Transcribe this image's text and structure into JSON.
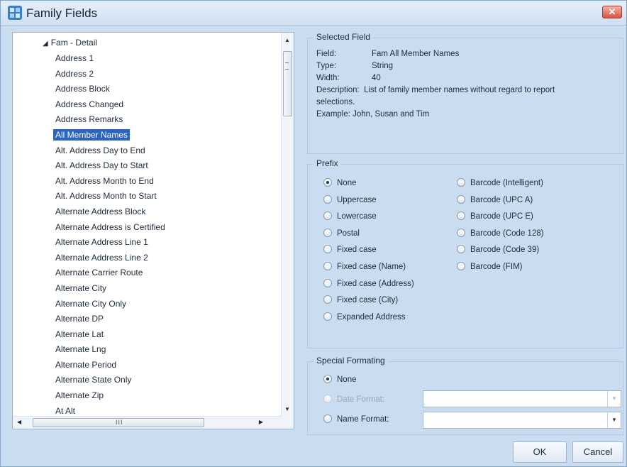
{
  "window": {
    "title": "Family Fields",
    "close_label": "✕"
  },
  "tree": {
    "root_label": "Fam - Detail",
    "items": [
      {
        "label": "Address 1"
      },
      {
        "label": "Address 2"
      },
      {
        "label": "Address Block"
      },
      {
        "label": "Address Changed"
      },
      {
        "label": "Address Remarks"
      },
      {
        "label": "All Member Names",
        "selected": true
      },
      {
        "label": "Alt. Address Day to End"
      },
      {
        "label": "Alt. Address Day to Start"
      },
      {
        "label": "Alt. Address Month to End"
      },
      {
        "label": "Alt. Address Month to Start"
      },
      {
        "label": "Alternate Address Block"
      },
      {
        "label": "Alternate Address is Certified"
      },
      {
        "label": "Alternate Address Line 1"
      },
      {
        "label": "Alternate Address Line 2"
      },
      {
        "label": "Alternate Carrier Route"
      },
      {
        "label": "Alternate City"
      },
      {
        "label": "Alternate City Only"
      },
      {
        "label": "Alternate DP"
      },
      {
        "label": "Alternate Lat"
      },
      {
        "label": "Alternate Lng"
      },
      {
        "label": "Alternate Period"
      },
      {
        "label": "Alternate State Only"
      },
      {
        "label": "Alternate Zip"
      },
      {
        "label": "At Alt"
      }
    ],
    "hscroll_grip": "III"
  },
  "selected_field": {
    "title": "Selected Field",
    "field_key": "Field:",
    "field_value": "Fam All Member Names",
    "type_key": "Type:",
    "type_value": "String",
    "width_key": "Width:",
    "width_value": "40",
    "description_key": "Description:",
    "description_line1": "List of family member names without regard to report",
    "description_line2": "selections.",
    "example": "Example: John, Susan and Tim"
  },
  "prefix": {
    "title": "Prefix",
    "left_options": [
      {
        "label": "None",
        "checked": true
      },
      {
        "label": "Uppercase"
      },
      {
        "label": "Lowercase"
      },
      {
        "label": "Postal"
      },
      {
        "label": "Fixed case"
      },
      {
        "label": "Fixed case (Name)"
      },
      {
        "label": "Fixed case (Address)"
      },
      {
        "label": "Fixed case (City)"
      },
      {
        "label": "Expanded Address"
      }
    ],
    "right_options": [
      {
        "label": "Barcode (Intelligent)"
      },
      {
        "label": "Barcode (UPC A)"
      },
      {
        "label": "Barcode (UPC E)"
      },
      {
        "label": "Barcode (Code 128)"
      },
      {
        "label": "Barcode (Code 39)"
      },
      {
        "label": "Barcode (FIM)"
      }
    ]
  },
  "special_formatting": {
    "title": "Special Formating",
    "none_label": "None",
    "date_format_label": "Date Format:",
    "date_format_value": "",
    "name_format_label": "Name Format:",
    "name_format_value": ""
  },
  "buttons": {
    "ok": "OK",
    "cancel": "Cancel"
  }
}
